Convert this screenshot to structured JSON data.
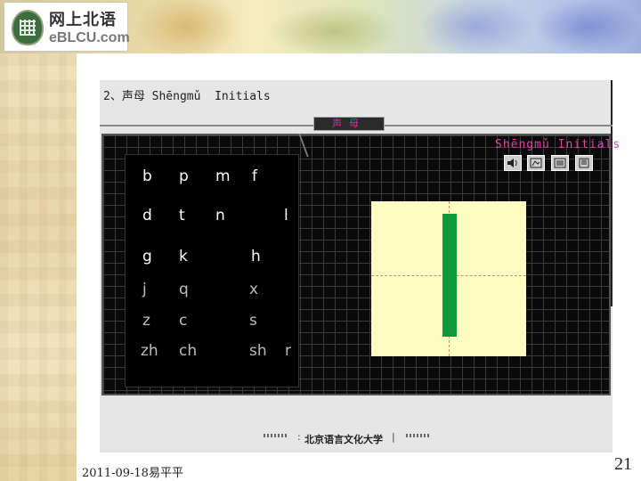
{
  "banner": {
    "logo_cn": "网上北语",
    "logo_en": "eBLCU.com"
  },
  "slide": {
    "heading": "2、声母 Shēngmǔ  Initials",
    "tab_label": "声母",
    "panel_title": "Shēngmǔ Initials",
    "icons": [
      "speaker-icon",
      "animation-icon",
      "list-icon",
      "book-icon"
    ],
    "letters": {
      "b": "b",
      "p": "p",
      "m": "m",
      "f": "f",
      "d": "d",
      "t": "t",
      "n": "n",
      "l": "l",
      "g": "g",
      "k": "k",
      "h": "h",
      "j": "j",
      "q": "q",
      "x": "x",
      "z": "z",
      "c": "c",
      "s": "s",
      "zh": "zh",
      "ch": "ch",
      "sh": "sh",
      "r": "r"
    },
    "stroke_color": "#0d9a3a",
    "pane_color": "#fffdc4",
    "title_color": "#e040b0"
  },
  "footer": {
    "university": "北京语言文化大学",
    "date": "2011-09-18易平平",
    "page": "21"
  }
}
